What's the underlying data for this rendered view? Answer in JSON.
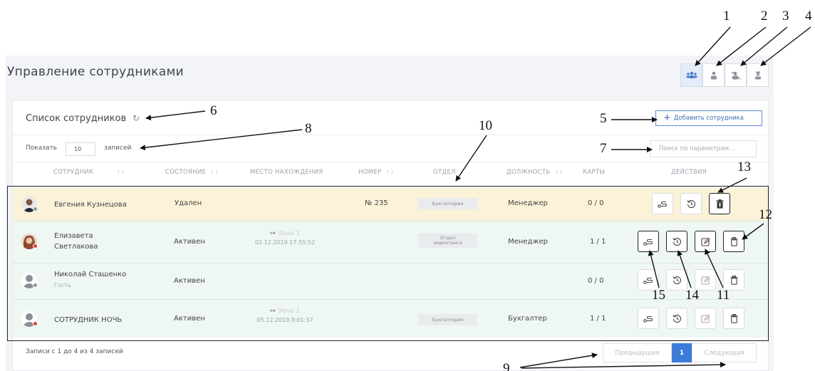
{
  "header": {
    "title": "Управление сотрудниками"
  },
  "view_buttons": [
    "all-employees-icon",
    "active-employee-icon",
    "deleted-employee-icon",
    "guest-employee-icon"
  ],
  "list": {
    "title": "Список сотрудников",
    "add_button": "Добавить сотрудника",
    "show_prefix": "Показать",
    "page_size": "10",
    "show_suffix": "записей",
    "search_placeholder": "Поиск по параметрам..."
  },
  "columns": [
    "СОТРУДНИК",
    "СОСТОЯНИЕ",
    "МЕСТО НАХОЖДЕНИЯ",
    "НОМЕР",
    "ОТДЕЛ",
    "ДОЛЖНОСТЬ",
    "КАРТЫ",
    "ДЕЙСТВИЯ"
  ],
  "rows": [
    {
      "name": "Евгения Кузнецова",
      "sub": "",
      "status": "Удален",
      "zone": "",
      "zone_date": "",
      "number": "№ 235",
      "dept": "Бухгалтерия",
      "position": "Менеджер",
      "cards": "0 / 0"
    },
    {
      "name": "Елизавета Светлакова",
      "name_l1": "Елизавета",
      "name_l2": "Светлакова",
      "sub": "",
      "status": "Активен",
      "zone": "Зона 1",
      "zone_date": "02.12.2019 17:55:52",
      "number": "",
      "dept": "Отдел маркетинга",
      "dept_l1": "Отдел",
      "dept_l2": "маркетинга",
      "position": "Менеджер",
      "cards": "1 / 1"
    },
    {
      "name": "Николай Сташенко",
      "sub": "Гость",
      "status": "Активен",
      "zone": "",
      "zone_date": "",
      "number": "",
      "dept": "",
      "position": "",
      "cards": "0 / 0"
    },
    {
      "name": "СОТРУДНИК НОЧЬ",
      "sub": "",
      "status": "Активен",
      "zone": "Зона 1",
      "zone_date": "05.12.2019 8:01:37",
      "number": "",
      "dept": "Бухгалтерия",
      "position": "Бухгалтер",
      "cards": "1 / 1"
    }
  ],
  "footer": {
    "info": "Записи с 1 до 4 из 4 записей",
    "prev": "Предыдущая",
    "page": "1",
    "next": "Следующая"
  },
  "callouts": [
    "1",
    "2",
    "3",
    "4",
    "5",
    "6",
    "7",
    "8",
    "9",
    "10",
    "11",
    "12",
    "13",
    "14",
    "15"
  ],
  "colors": {
    "accent": "#3d7bd9",
    "deleted_row": "#fbf2d8",
    "active_row": "#eff7f2"
  }
}
